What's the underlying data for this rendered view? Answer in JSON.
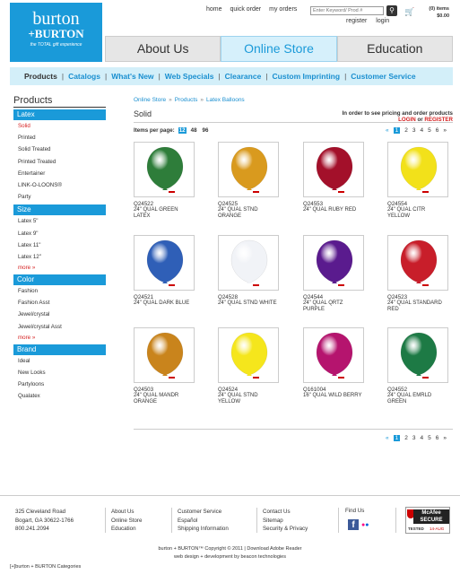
{
  "logo": {
    "line1": "burton",
    "line2": "+BURTON",
    "line3": "the TOTAL gift experience"
  },
  "toplinks": {
    "home": "home",
    "quick_order": "quick order",
    "my_orders": "my orders",
    "search_placeholder": "Enter Keyword/ Prod #",
    "register": "register",
    "login": "login"
  },
  "cart": {
    "items": "(0) items",
    "total": "$0.00"
  },
  "tabs": [
    {
      "label": "About Us"
    },
    {
      "label": "Online Store"
    },
    {
      "label": "Education"
    }
  ],
  "nav": [
    "Products",
    "Catalogs",
    "What's New",
    "Web Specials",
    "Clearance",
    "Custom Imprinting",
    "Customer Service"
  ],
  "sidebar": {
    "title": "Products",
    "sections": [
      {
        "title": "Latex",
        "items": [
          "Solid",
          "Printed",
          "Solid Treated",
          "Printed Treated",
          "Entertainer",
          "LINK-O-LOONS®",
          "Party"
        ]
      },
      {
        "title": "Size",
        "items": [
          "Latex 5\"",
          "Latex 9\"",
          "Latex 11\"",
          "Latex 12\"",
          "more »"
        ]
      },
      {
        "title": "Color",
        "items": [
          "Fashion",
          "Fashion Asst",
          "Jewel/crystal",
          "Jewel/crystal Asst",
          "more »"
        ]
      },
      {
        "title": "Brand",
        "items": [
          "Ideal",
          "New Looks",
          "Partyloons",
          "Qualatex"
        ]
      }
    ]
  },
  "breadcrumb": [
    "Online Store",
    "Products",
    "Latex Balloons"
  ],
  "breadcrumb_sep": "»",
  "page_title": "Solid",
  "pricing_note": {
    "line1": "In order to see pricing and order products",
    "login": "LOGIN",
    "or": "or",
    "register": "REGISTER"
  },
  "items_per_page": {
    "label": "Items per page:",
    "options": [
      "12",
      "48",
      "96"
    ],
    "selected": "12"
  },
  "pager": {
    "prev": "«",
    "pages": [
      "1",
      "2",
      "3",
      "4",
      "5",
      "6"
    ],
    "current": "1",
    "next": "»"
  },
  "products": [
    {
      "code": "Q24522",
      "name": "24\" QUAL GREEN LATEX",
      "color": "#2e7d3a"
    },
    {
      "code": "Q24525",
      "name": "24\" QUAL STND ORANGE",
      "color": "#d99a1e"
    },
    {
      "code": "Q24553",
      "name": "24\" QUAL RUBY RED",
      "color": "#a3102a"
    },
    {
      "code": "Q24554",
      "name": "24\" QUAL CITR YELLOW",
      "color": "#f2e11a"
    },
    {
      "code": "Q24521",
      "name": "24\" QUAL DARK BLUE",
      "color": "#2f5fb7"
    },
    {
      "code": "Q24528",
      "name": "24\" QUAL STND WHITE",
      "color": "#f1f3f7"
    },
    {
      "code": "Q24544",
      "name": "24\" QUAL QRTZ PURPLE",
      "color": "#5a1b8e"
    },
    {
      "code": "Q24523",
      "name": "24\" QUAL STANDARD RED",
      "color": "#c81e2a"
    },
    {
      "code": "Q24503",
      "name": "24\" QUAL MANDR ORANGE",
      "color": "#c9841c"
    },
    {
      "code": "Q24524",
      "name": "24\" QUAL STND YELLOW",
      "color": "#f5e61c"
    },
    {
      "code": "Q161004",
      "name": "16\" QUAL WILD BERRY",
      "color": "#b5146e"
    },
    {
      "code": "Q24552",
      "name": "24\" QUAL EMRLD GREEN",
      "color": "#1d7a45"
    }
  ],
  "footer": {
    "address": [
      "325 Cleveland Road",
      "Bogart, GA 30622-1766",
      "800.241.2094"
    ],
    "col2": [
      "About Us",
      "Online Store",
      "Education"
    ],
    "col3": [
      "Customer Service",
      "Español",
      "Shipping Information"
    ],
    "col4": [
      "Contact Us",
      "Sitemap",
      "Security & Privacy"
    ],
    "find_us": "Find Us",
    "facebook": "f",
    "mcafee": {
      "line1": "McAfee",
      "line2": "SECURE",
      "tested": "TESTED",
      "date": "14-AUG"
    },
    "copyright": "burton + BURTON™ Copyright © 2011 | Download Adobe Reader",
    "credit": "web design + development by beacon technologies",
    "categories": "[+]burton + BURTON Categories"
  }
}
